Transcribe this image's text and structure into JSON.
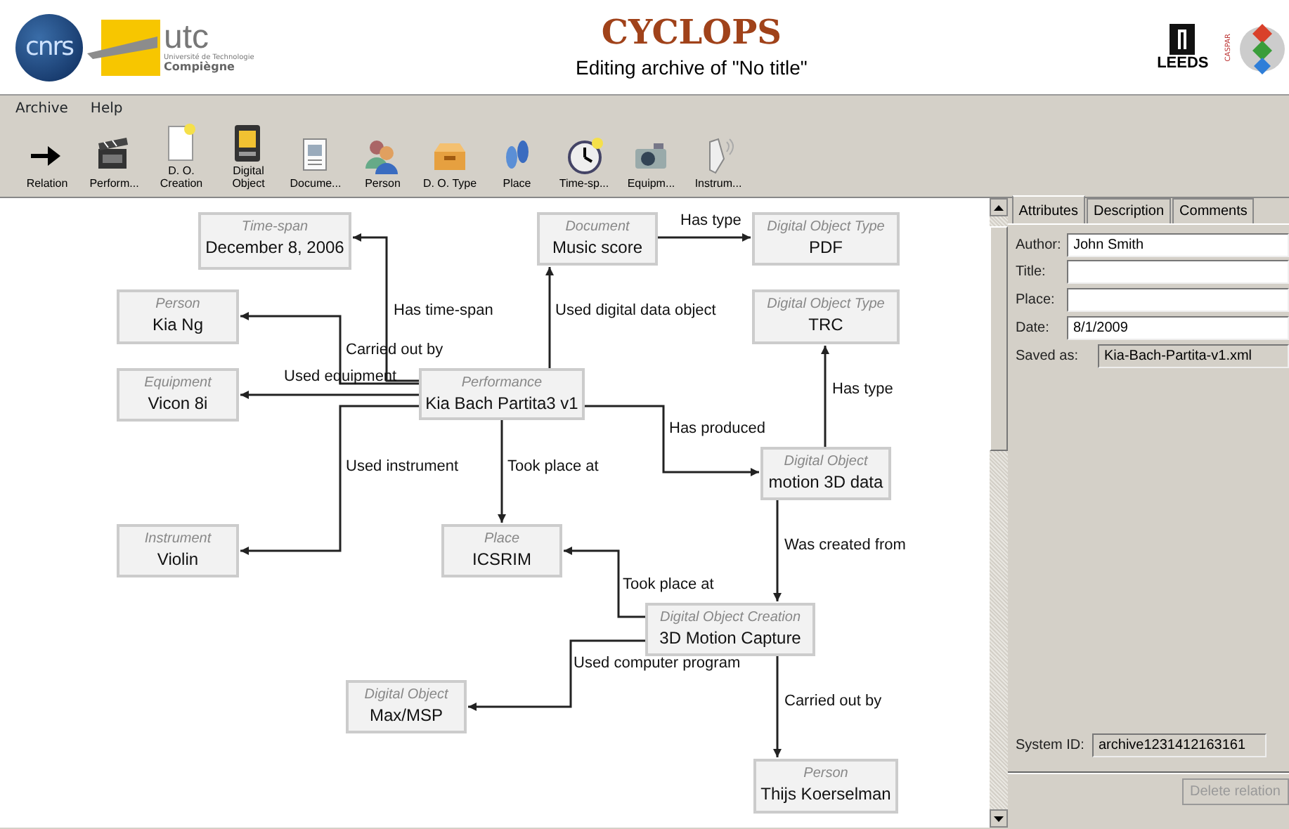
{
  "header": {
    "logos": {
      "cnrs": "cnrs",
      "utc": "utc",
      "utc_sub": "Université de Technologie",
      "utc_city": "Compiègne",
      "leeds": "LEEDS",
      "caspar": "CASPAR"
    },
    "app_name": "CYCLOPS",
    "title": "Editing archive of \"No title\""
  },
  "menu": [
    "Archive",
    "Help"
  ],
  "toolbar": [
    {
      "label": "Relation"
    },
    {
      "label": "Perform..."
    },
    {
      "label": "D. O. Creation"
    },
    {
      "label": "Digital Object"
    },
    {
      "label": "Docume..."
    },
    {
      "label": "Person"
    },
    {
      "label": "D. O. Type"
    },
    {
      "label": "Place"
    },
    {
      "label": "Time-sp..."
    },
    {
      "label": "Equipm..."
    },
    {
      "label": "Instrum..."
    }
  ],
  "diagram": {
    "nodes": [
      {
        "type": "Time-span",
        "name": "December 8, 2006"
      },
      {
        "type": "Person",
        "name": "Kia Ng"
      },
      {
        "type": "Equipment",
        "name": "Vicon 8i"
      },
      {
        "type": "Performance",
        "name": "Kia Bach Partita3 v1"
      },
      {
        "type": "Document",
        "name": "Music score"
      },
      {
        "type": "Digital Object Type",
        "name": "PDF"
      },
      {
        "type": "Digital Object Type",
        "name": "TRC"
      },
      {
        "type": "Digital Object",
        "name": "motion 3D data"
      },
      {
        "type": "Instrument",
        "name": "Violin"
      },
      {
        "type": "Place",
        "name": "ICSRIM"
      },
      {
        "type": "Digital Object Creation",
        "name": "3D Motion Capture"
      },
      {
        "type": "Digital Object",
        "name": "Max/MSP"
      },
      {
        "type": "Person",
        "name": "Thijs Koerselman"
      }
    ],
    "edges": [
      {
        "label": "Has type"
      },
      {
        "label": "Has time-span"
      },
      {
        "label": "Used digital data object"
      },
      {
        "label": "Carried out by"
      },
      {
        "label": "Used equipment"
      },
      {
        "label": "Has type"
      },
      {
        "label": "Has produced"
      },
      {
        "label": "Used instrument"
      },
      {
        "label": "Took place at"
      },
      {
        "label": "Was created from"
      },
      {
        "label": "Took place at"
      },
      {
        "label": "Used computer program"
      },
      {
        "label": "Carried out by"
      }
    ]
  },
  "panel": {
    "tabs": [
      {
        "label": "Attributes",
        "selected": true
      },
      {
        "label": "Description",
        "selected": false
      },
      {
        "label": "Comments",
        "selected": false
      }
    ],
    "fields": [
      {
        "label": "Author:",
        "value": "John Smith",
        "kind": "input"
      },
      {
        "label": "Title:",
        "kind": "input"
      },
      {
        "label": "Place:",
        "kind": "input"
      },
      {
        "label": "Date:",
        "value": "8/1/2009",
        "kind": "input"
      },
      {
        "label": "Saved as:",
        "value": "Kia-Bach-Partita-v1.xml",
        "kind": "readonly"
      }
    ],
    "system_id": {
      "label": "System ID:",
      "value": "archive1231412163161"
    },
    "delete_button": {
      "label": "Delete relation",
      "disabled": true
    }
  }
}
